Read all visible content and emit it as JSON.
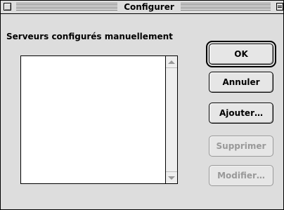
{
  "window": {
    "title": "Configurer"
  },
  "dialog": {
    "section_label": "Serveurs configurés manuellement",
    "server_list": []
  },
  "buttons": {
    "ok": "OK",
    "cancel": "Annuler",
    "add": "Ajouter…",
    "remove": "Supprimer",
    "modify": "Modifier…"
  },
  "states": {
    "remove_enabled": false,
    "modify_enabled": false
  }
}
